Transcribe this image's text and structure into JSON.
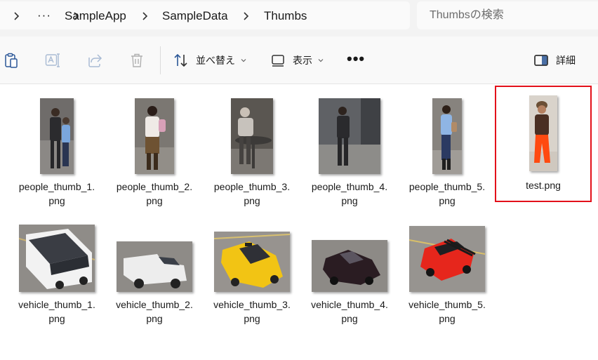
{
  "breadcrumb": {
    "overflow": "···",
    "items": [
      "SampleApp",
      "SampleData",
      "Thumbs"
    ]
  },
  "search": {
    "placeholder": "Thumbsの検索"
  },
  "commandbar": {
    "sort_label": "並べ替え",
    "view_label": "表示",
    "more_label": "•••",
    "details_label": "詳細",
    "icons": [
      "paste-icon",
      "rename-icon",
      "share-icon",
      "delete-icon",
      "sort-icon",
      "view-icon",
      "more-icon",
      "details-pane-icon"
    ]
  },
  "files": {
    "row1": [
      {
        "name": "people_thumb_1.\npng",
        "kind": "person"
      },
      {
        "name": "people_thumb_2.\npng",
        "kind": "person"
      },
      {
        "name": "people_thumb_3.\npng",
        "kind": "person"
      },
      {
        "name": "people_thumb_4.\npng",
        "kind": "person"
      },
      {
        "name": "people_thumb_5.\npng",
        "kind": "person"
      },
      {
        "name": "test.png",
        "kind": "person",
        "selected": true
      }
    ],
    "row2": [
      {
        "name": "vehicle_thumb_1.\npng",
        "kind": "vehicle"
      },
      {
        "name": "vehicle_thumb_2.\npng",
        "kind": "vehicle"
      },
      {
        "name": "vehicle_thumb_3.\npng",
        "kind": "vehicle"
      },
      {
        "name": "vehicle_thumb_4.\npng",
        "kind": "vehicle"
      },
      {
        "name": "vehicle_thumb_5.\npng",
        "kind": "vehicle"
      }
    ]
  },
  "colors": {
    "selection_border": "#e3101a",
    "accent_icon": "#2b5797",
    "disabled_icon": "#a0a0a0"
  }
}
